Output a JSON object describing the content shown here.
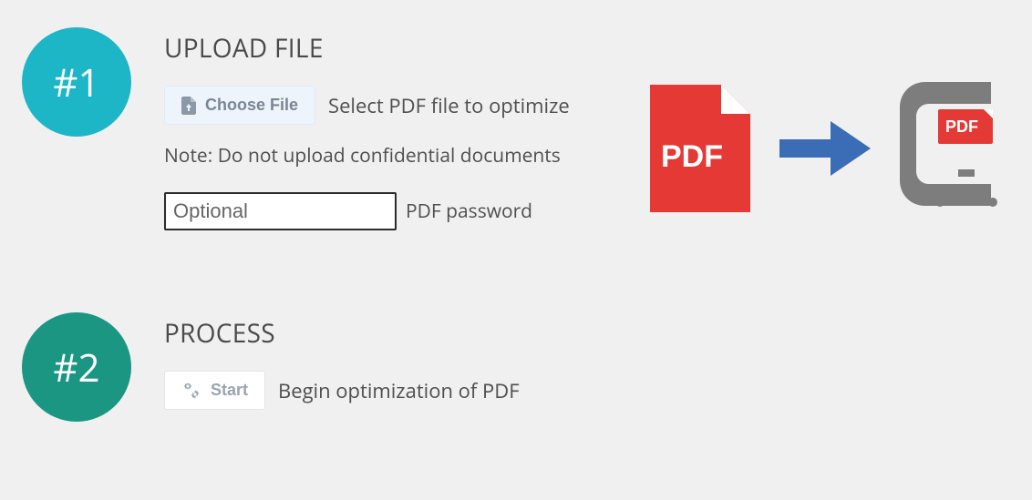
{
  "step1": {
    "badge": "#1",
    "heading": "UPLOAD FILE",
    "choose_label": "Choose File",
    "choose_hint": "Select PDF file to optimize",
    "note": "Note: Do not upload confidential documents",
    "pw_placeholder": "Optional",
    "pw_label": "PDF password"
  },
  "step2": {
    "badge": "#2",
    "heading": "PROCESS",
    "start_label": "Start",
    "start_hint": "Begin optimization of PDF"
  },
  "illustration": {
    "pdf_label": "PDF",
    "mini_label": "PDF"
  }
}
